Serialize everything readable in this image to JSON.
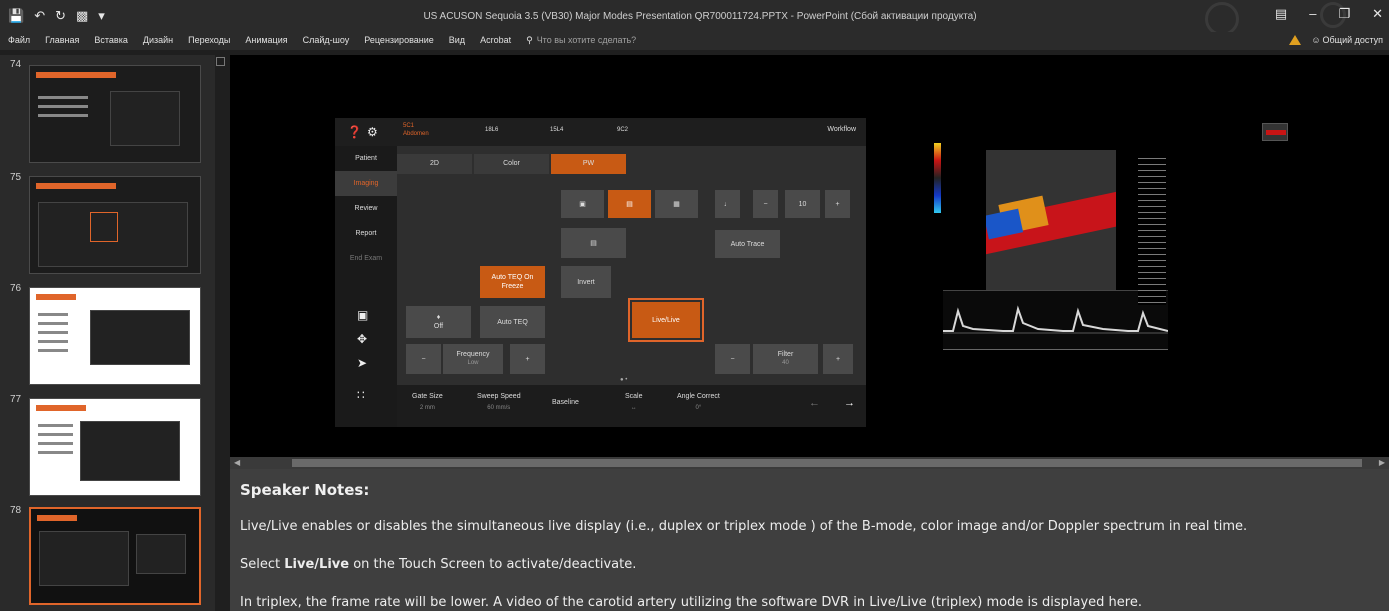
{
  "window": {
    "title": "US ACUSON Sequoia 3.5 (VB30) Major Modes Presentation QR700011724.PPTX - PowerPoint (Сбой активации продукта)",
    "qat": [
      "save-icon",
      "undo-icon",
      "redo-icon",
      "presentation-icon",
      "customize-icon"
    ]
  },
  "ribbon": {
    "tabs": [
      "Файл",
      "Главная",
      "Вставка",
      "Дизайн",
      "Переходы",
      "Анимация",
      "Слайд-шоу",
      "Рецензирование",
      "Вид",
      "Acrobat"
    ],
    "tell_me": "Что вы хотите сделать?",
    "share": "Общий доступ"
  },
  "thumbnails": [
    {
      "number": "74",
      "title": "Auto TEQ (tissue equalization technology) Doppler optimization"
    },
    {
      "number": "75",
      "title": "Auto TEQ (tissue equalization technology) Doppler optimization"
    },
    {
      "number": "76",
      "title": "Auto TEQ on Freeze"
    },
    {
      "number": "77",
      "title": "Doppler Auto TEQ on Freeze"
    },
    {
      "number": "78",
      "title": "Live/Live (triplex)"
    }
  ],
  "touchscreen": {
    "probes": [
      {
        "name": "5C1",
        "sub": "Abdomen",
        "selected": true
      },
      {
        "name": "18L6",
        "sub": "",
        "selected": false
      },
      {
        "name": "15L4",
        "sub": "",
        "selected": false
      },
      {
        "name": "9C2",
        "sub": "",
        "selected": false
      }
    ],
    "workflow": "Workflow",
    "left_menu": [
      "Patient",
      "Imaging",
      "Review",
      "Report",
      "End Exam"
    ],
    "mode_tabs": [
      "2D",
      "Color",
      "PW"
    ],
    "buttons": {
      "auto_teq_freeze": "Auto TEQ On Freeze",
      "auto_teq": "Auto TEQ",
      "off": "Off",
      "invert": "Invert",
      "live_live": "Live/Live",
      "auto_trace": "Auto Trace",
      "volume_value": "10",
      "minus": "−",
      "plus": "+",
      "frequency": "Frequency",
      "frequency_value": "Low",
      "filter": "Filter",
      "filter_value": "40"
    },
    "bottom": [
      {
        "label": "Gate Size",
        "value": "2 mm"
      },
      {
        "label": "Sweep Speed",
        "value": "60 mm/s"
      },
      {
        "label": "Baseline",
        "value": ""
      },
      {
        "label": "Scale",
        "value": ""
      },
      {
        "label": "Angle Correct",
        "value": "0°"
      }
    ]
  },
  "notes": {
    "heading": "Speaker Notes:",
    "line1": "Live/Live enables or disables the simultaneous live display (i.e., duplex or triplex mode ) of the B-mode, color image and/or Doppler spectrum in real time.",
    "line2_pre": "Select ",
    "line2_bold": "Live/Live",
    "line2_post": " on the Touch Screen to activate/deactivate.",
    "line3": "In triplex, the frame rate will be lower. A video of the carotid artery utilizing the software DVR  in Live/Live (triplex) mode is displayed here."
  },
  "colors": {
    "accent": "#e0652a",
    "button_orange": "#c85a14"
  }
}
